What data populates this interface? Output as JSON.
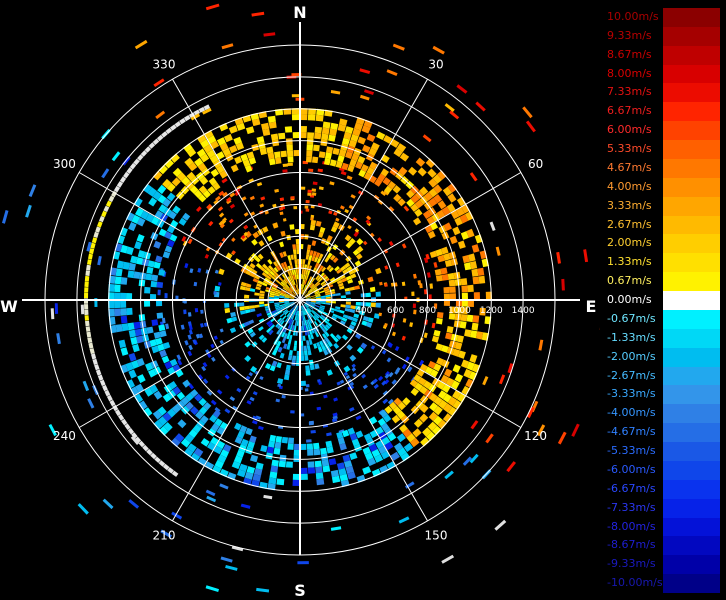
{
  "chart_data": {
    "type": "polar-radial-velocity",
    "compass_labels": {
      "north": "N",
      "east": "E",
      "south": "S",
      "west": "W"
    },
    "angle_ticks": [
      "30",
      "60",
      "120",
      "150",
      "210",
      "240",
      "300",
      "330"
    ],
    "angle_tick_degrees": [
      30,
      60,
      120,
      150,
      210,
      240,
      300,
      330
    ],
    "range_ticks": [
      "400",
      "600",
      "800",
      "1000",
      "1200",
      "1400"
    ],
    "range_tick_values": [
      400,
      600,
      800,
      1000,
      1200,
      1400
    ],
    "range_max": 1600,
    "grid": true,
    "legend_position": "right",
    "colorbar": {
      "labels": [
        "10.00m/s",
        "9.33m/s",
        "8.67m/s",
        "8.00m/s",
        "7.33m/s",
        "6.67m/s",
        "6.00m/s",
        "5.33m/s",
        "4.67m/s",
        "4.00m/s",
        "3.33m/s",
        "2.67m/s",
        "2.00m/s",
        "1.33m/s",
        "0.67m/s",
        "0.00m/s",
        "-0.67m/s",
        "-1.33m/s",
        "-2.00m/s",
        "-2.67m/s",
        "-3.33m/s",
        "-4.00m/s",
        "-4.67m/s",
        "-5.33m/s",
        "-6.00m/s",
        "-6.67m/s",
        "-7.33m/s",
        "-8.00m/s",
        "-8.67m/s",
        "-9.33m/s",
        "-10.00m/s"
      ],
      "values": [
        10.0,
        9.33,
        8.67,
        8.0,
        7.33,
        6.67,
        6.0,
        5.33,
        4.67,
        4.0,
        3.33,
        2.67,
        2.0,
        1.33,
        0.67,
        0.0,
        -0.67,
        -1.33,
        -2.0,
        -2.67,
        -3.33,
        -4.0,
        -4.67,
        -5.33,
        -6.0,
        -6.67,
        -7.33,
        -8.0,
        -8.67,
        -9.33,
        -10.0
      ],
      "colors": [
        "#8b0000",
        "#a50000",
        "#bf0000",
        "#d80000",
        "#ec0c00",
        "#ff2400",
        "#ff4200",
        "#ff6000",
        "#ff7800",
        "#ff9000",
        "#ffa600",
        "#ffba00",
        "#ffce00",
        "#ffe000",
        "#fff200",
        "#ffffff",
        "#00f0ff",
        "#00d8f6",
        "#00bdf0",
        "#22a8ee",
        "#3395ea",
        "#2f80e6",
        "#256ee6",
        "#1a58e6",
        "#0f46ea",
        "#0a33ee",
        "#0622e8",
        "#0412d8",
        "#0208c0",
        "#0000a8",
        "#000088"
      ],
      "label_colors": [
        "#a80000",
        "#b80000",
        "#c80000",
        "#d80000",
        "#e51010",
        "#f01e1e",
        "#ff2a2a",
        "#ff4a2a",
        "#ff7a30",
        "#ff9a30",
        "#ffae30",
        "#ffc030",
        "#ffd030",
        "#ffe030",
        "#fff060",
        "#ffffff",
        "#6fe6ff",
        "#66dcff",
        "#55ccff",
        "#45bbff",
        "#3aa9ff",
        "#3596ff",
        "#3080ff",
        "#2a6cff",
        "#2a5aff",
        "#2a48ff",
        "#2a36f0",
        "#2222e0",
        "#1e1ed0",
        "#1a1ac0",
        "#1818b0"
      ]
    }
  }
}
